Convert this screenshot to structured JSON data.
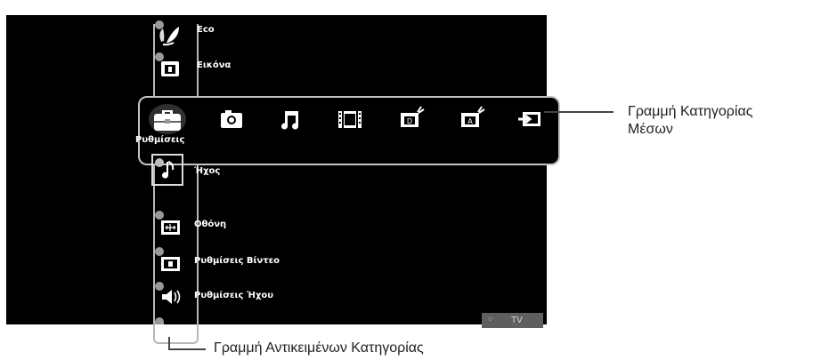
{
  "left_menu": {
    "items_above": [
      {
        "label": "Eco",
        "icon": "eco-leaf-icon"
      },
      {
        "label": "Εικόνα",
        "icon": "picture-icon"
      }
    ],
    "items_below": [
      {
        "label": "Ήχος",
        "icon": "music-note-icon"
      },
      {
        "label": "Οθόνη",
        "icon": "screen-icon"
      },
      {
        "label": "Ρυθμίσεις Βίντεο",
        "icon": "video-settings-icon"
      },
      {
        "label": "Ρυθμίσεις Ήχου",
        "icon": "speaker-icon"
      }
    ]
  },
  "media_bar": {
    "selected_label": "Ρυθμίσεις",
    "items": [
      {
        "icon": "toolbox-icon",
        "selected": true
      },
      {
        "icon": "camera-icon"
      },
      {
        "icon": "music-icon"
      },
      {
        "icon": "film-icon"
      },
      {
        "icon": "digital-tv-icon"
      },
      {
        "icon": "analog-tv-icon"
      },
      {
        "icon": "input-icon"
      }
    ]
  },
  "status": {
    "source": "TV"
  },
  "callouts": {
    "media_bar": [
      "Γραμμή Κατηγορίας",
      "Μέσων"
    ],
    "category_items": "Γραμμή Αντικειμένων Κατηγορίας"
  }
}
